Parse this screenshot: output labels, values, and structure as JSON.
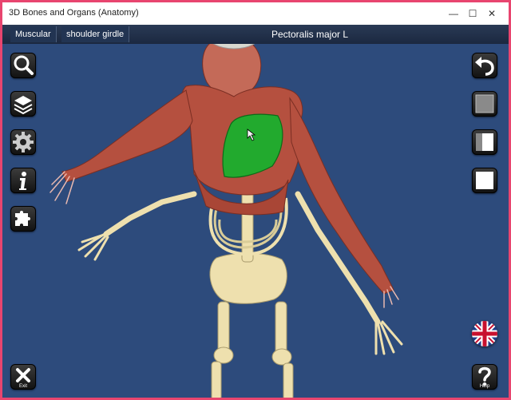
{
  "window": {
    "title": "3D Bones and Organs (Anatomy)",
    "controls": {
      "minimize": "—",
      "maximize": "☐",
      "close": "✕"
    }
  },
  "toolbar": {
    "breadcrumbs": [
      "Muscular",
      "shoulder girdle"
    ],
    "selected_structure": "Pectoralis major L"
  },
  "left_tools": [
    "search-icon",
    "layers-icon",
    "gear-icon",
    "info-icon",
    "puzzle-icon",
    "exit-icon"
  ],
  "right_tools": [
    "undo-icon",
    "gray-square-icon",
    "half-square-icon",
    "white-square-icon",
    "uk-flag-icon",
    "help-icon"
  ],
  "labels": {
    "exit": "Exit",
    "help": "Help"
  },
  "colors": {
    "background": "#2d4b7c",
    "highlight": "#22aa2e",
    "muscle": "#b5503f",
    "bone": "#efe2b2"
  }
}
